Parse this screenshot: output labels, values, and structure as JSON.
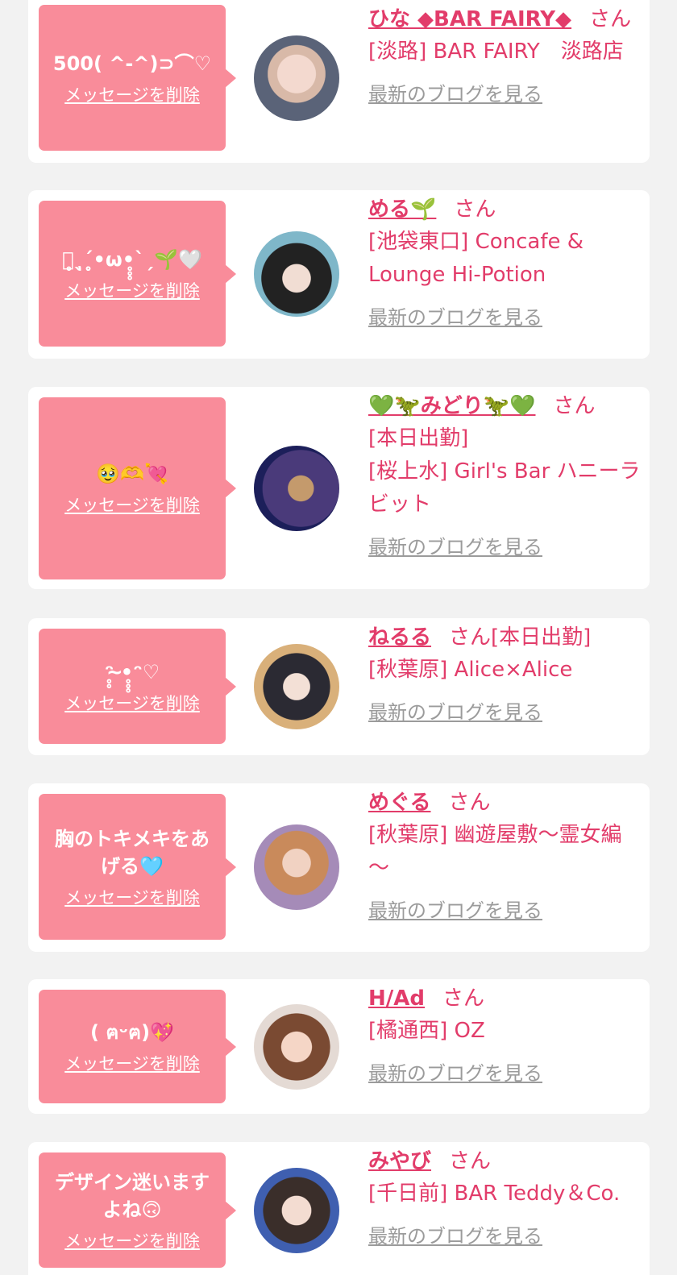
{
  "items": [
    {
      "message": "500( ^-^)⊃⌒♡",
      "delete_label": "メッセージを削除",
      "name": "ひな ◆BAR FAIRY◆",
      "honorific": "さん",
      "tag": "",
      "shop": "[淡路] BAR FAIRY　淡路店",
      "blog_label": "最新のブログを見る"
    },
    {
      "message": "｡̥ٖˎ´•̥̥̥ω•̥̥̥`ˏ🌱🤍",
      "delete_label": "メッセージを削除",
      "name": "める🌱",
      "honorific": "さん",
      "tag": "",
      "shop": "[池袋東口] Concafe & Lounge Hi-Potion",
      "blog_label": "最新のブログを見る"
    },
    {
      "message": "🥹🫶💘",
      "delete_label": "メッセージを削除",
      "name": "💚🦖みどり🦖💚",
      "honorific": "さん",
      "tag": "[本日出勤]",
      "shop": "[桜上水] Girl's Bar ハニーラビット",
      "blog_label": "最新のブログを見る"
    },
    {
      "message": "ᵔ̥̥ ̴̴•̥̥̥ᵔ♡",
      "delete_label": "メッセージを削除",
      "name": "ねるる",
      "honorific": "さん",
      "tag": "[本日出勤]",
      "shop": "[秋葉原] Alice×Alice",
      "blog_label": "最新のブログを見る"
    },
    {
      "message": "胸のトキメキをあげる🩵",
      "delete_label": "メッセージを削除",
      "name": "めぐる",
      "honorific": "さん",
      "tag": "",
      "shop": "[秋葉原] 幽遊屋敷～霊女編～",
      "blog_label": "最新のブログを見る"
    },
    {
      "message": "( ฅᵕฅ)💖",
      "delete_label": "メッセージを削除",
      "name": "H/Ad",
      "honorific": "さん",
      "tag": "",
      "shop": "[橘通西] OZ",
      "blog_label": "最新のブログを見る"
    },
    {
      "message": "デザイン迷いますよね🙃",
      "delete_label": "メッセージを削除",
      "name": "みやび",
      "honorific": "さん",
      "tag": "",
      "shop": "[千日前] BAR Teddy＆Co.",
      "blog_label": "最新のブログを見る"
    }
  ],
  "colors": {
    "bubble": "#f98c9a",
    "accent": "#e23c6a",
    "muted_link": "#9b9b9b",
    "background": "#f2f2f2"
  }
}
